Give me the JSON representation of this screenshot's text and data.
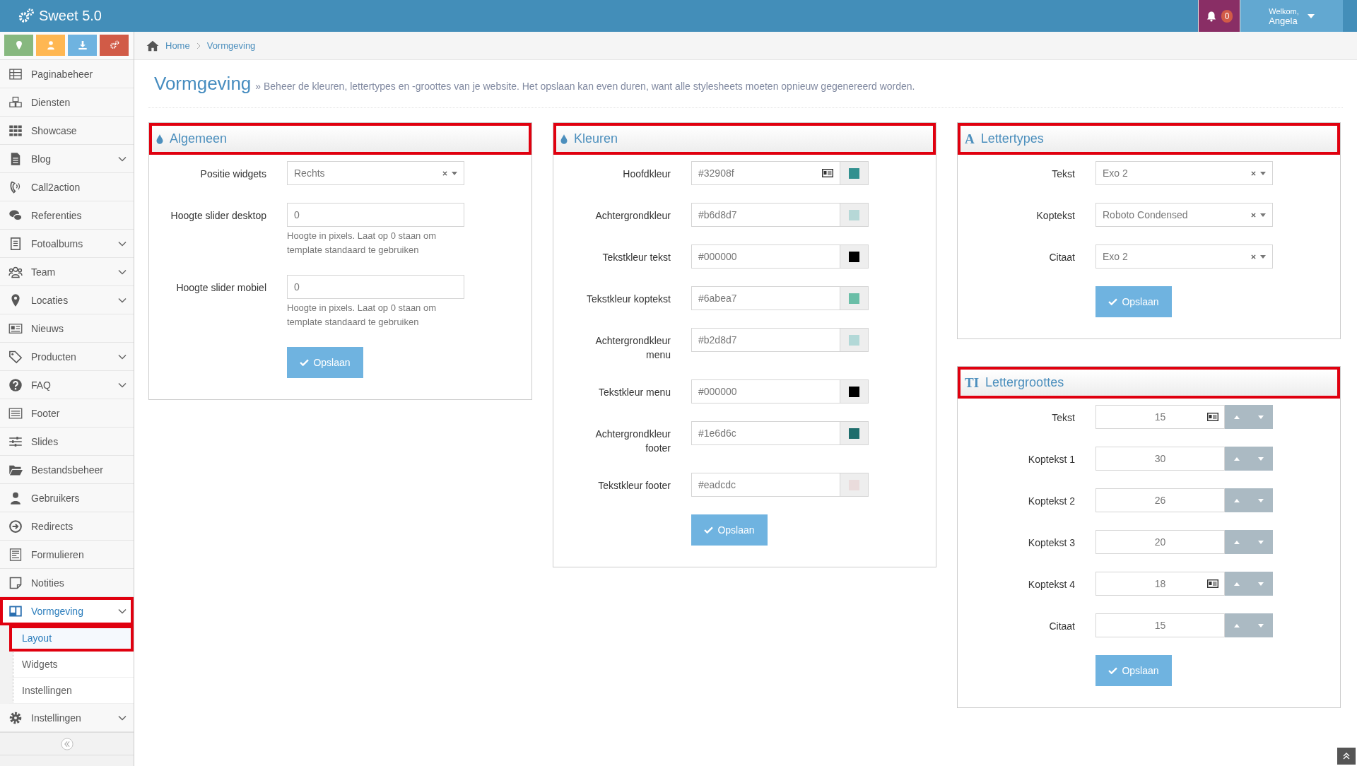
{
  "topbar": {
    "brand": "Sweet 5.0",
    "notification_count": "0",
    "greeting": "Welkom,",
    "user_name": "Angela"
  },
  "quick_buttons": [
    {
      "color": "#87b87f"
    },
    {
      "color": "#ffb752"
    },
    {
      "color": "#6fb3e0"
    },
    {
      "color": "#d15b47"
    }
  ],
  "sidebar": {
    "items": [
      {
        "label": "Paginabeheer",
        "expandable": false,
        "selected": false,
        "highlighted": false
      },
      {
        "label": "Diensten",
        "expandable": false,
        "selected": false,
        "highlighted": false
      },
      {
        "label": "Showcase",
        "expandable": false,
        "selected": false,
        "highlighted": false
      },
      {
        "label": "Blog",
        "expandable": true,
        "selected": false,
        "highlighted": false
      },
      {
        "label": "Call2action",
        "expandable": false,
        "selected": false,
        "highlighted": false
      },
      {
        "label": "Referenties",
        "expandable": false,
        "selected": false,
        "highlighted": false
      },
      {
        "label": "Fotoalbums",
        "expandable": true,
        "selected": false,
        "highlighted": false
      },
      {
        "label": "Team",
        "expandable": true,
        "selected": false,
        "highlighted": false
      },
      {
        "label": "Locaties",
        "expandable": true,
        "selected": false,
        "highlighted": false
      },
      {
        "label": "Nieuws",
        "expandable": false,
        "selected": false,
        "highlighted": false
      },
      {
        "label": "Producten",
        "expandable": true,
        "selected": false,
        "highlighted": false
      },
      {
        "label": "FAQ",
        "expandable": true,
        "selected": false,
        "highlighted": false
      },
      {
        "label": "Footer",
        "expandable": false,
        "selected": false,
        "highlighted": false
      },
      {
        "label": "Slides",
        "expandable": false,
        "selected": false,
        "highlighted": false
      },
      {
        "label": "Bestandsbeheer",
        "expandable": false,
        "selected": false,
        "highlighted": false
      },
      {
        "label": "Gebruikers",
        "expandable": false,
        "selected": false,
        "highlighted": false
      },
      {
        "label": "Redirects",
        "expandable": false,
        "selected": false,
        "highlighted": false
      },
      {
        "label": "Formulieren",
        "expandable": false,
        "selected": false,
        "highlighted": false
      },
      {
        "label": "Notities",
        "expandable": false,
        "selected": false,
        "highlighted": false
      },
      {
        "label": "Vormgeving",
        "expandable": true,
        "selected": true,
        "highlighted": true,
        "children": [
          {
            "label": "Layout",
            "selected": true,
            "highlighted": true
          },
          {
            "label": "Widgets",
            "selected": false,
            "highlighted": false
          },
          {
            "label": "Instellingen",
            "selected": false,
            "highlighted": false
          }
        ]
      },
      {
        "label": "Instellingen",
        "expandable": true,
        "selected": false,
        "highlighted": false
      }
    ]
  },
  "breadcrumb": [
    "Home",
    "Vormgeving"
  ],
  "page": {
    "title": "Vormgeving",
    "description": "» Beheer de kleuren, lettertypes en -groottes van je website. Het opslaan kan even duren, want alle stylesheets moeten opnieuw gegenereerd worden."
  },
  "columns": [
    {
      "panels": [
        {
          "title": "Algemeen",
          "highlighted": true,
          "button": "Opslaan",
          "fields": [
            {
              "kind": "select",
              "label": "Positie widgets",
              "value": "Rechts"
            },
            {
              "kind": "text",
              "label": "Hoogte slider desktop",
              "value": "0",
              "help": "Hoogte in pixels. Laat op 0 staan om template standaard te gebruiken"
            },
            {
              "kind": "text",
              "label": "Hoogte slider mobiel",
              "value": "0",
              "help": "Hoogte in pixels. Laat op 0 staan om template standaard te gebruiken"
            }
          ]
        }
      ]
    },
    {
      "panels": [
        {
          "title": "Kleuren",
          "highlighted": true,
          "button": "Opslaan",
          "fields": [
            {
              "kind": "color",
              "label": "Hoofdkleur",
              "value": "#32908f",
              "color": "#32908f",
              "autofill_icon": true
            },
            {
              "kind": "color",
              "label": "Achtergrondkleur",
              "value": "#b6d8d7",
              "color": "#b6d8d7",
              "autofill_icon": false
            },
            {
              "kind": "color",
              "label": "Tekstkleur tekst",
              "value": "#000000",
              "color": "#000000",
              "autofill_icon": false
            },
            {
              "kind": "color",
              "label": "Tekstkleur koptekst",
              "value": "#6abea7",
              "color": "#6abea7",
              "autofill_icon": false
            },
            {
              "kind": "color",
              "label": "Achtergrondkleur menu",
              "value": "#b2d8d7",
              "color": "#b2d8d7",
              "autofill_icon": false
            },
            {
              "kind": "color",
              "label": "Tekstkleur menu",
              "value": "#000000",
              "color": "#000000",
              "autofill_icon": false
            },
            {
              "kind": "color",
              "label": "Achtergrondkleur footer",
              "value": "#1e6d6c",
              "color": "#1e6d6c",
              "autofill_icon": false
            },
            {
              "kind": "color",
              "label": "Tekstkleur footer",
              "value": "#eadcdc",
              "color": "#eadcdc",
              "autofill_icon": false
            }
          ]
        }
      ]
    },
    {
      "panels": [
        {
          "title": "Lettertypes",
          "icon_text": "A",
          "highlighted": true,
          "button": "Opslaan",
          "fields": [
            {
              "kind": "select",
              "label": "Tekst",
              "value": "Exo 2"
            },
            {
              "kind": "select",
              "label": "Koptekst",
              "value": "Roboto Condensed"
            },
            {
              "kind": "select",
              "label": "Citaat",
              "value": "Exo 2"
            }
          ]
        },
        {
          "title": "Lettergroottes",
          "icon_text": "TI",
          "highlighted": true,
          "button": "Opslaan",
          "fields": [
            {
              "kind": "number",
              "label": "Tekst",
              "value": "15",
              "autofill_icon": true
            },
            {
              "kind": "number",
              "label": "Koptekst 1",
              "value": "30",
              "autofill_icon": false
            },
            {
              "kind": "number",
              "label": "Koptekst 2",
              "value": "26",
              "autofill_icon": false
            },
            {
              "kind": "number",
              "label": "Koptekst 3",
              "value": "20",
              "autofill_icon": false
            },
            {
              "kind": "number",
              "label": "Koptekst 4",
              "value": "18",
              "autofill_icon": true
            },
            {
              "kind": "number",
              "label": "Citaat",
              "value": "15",
              "autofill_icon": false
            }
          ]
        }
      ]
    }
  ]
}
